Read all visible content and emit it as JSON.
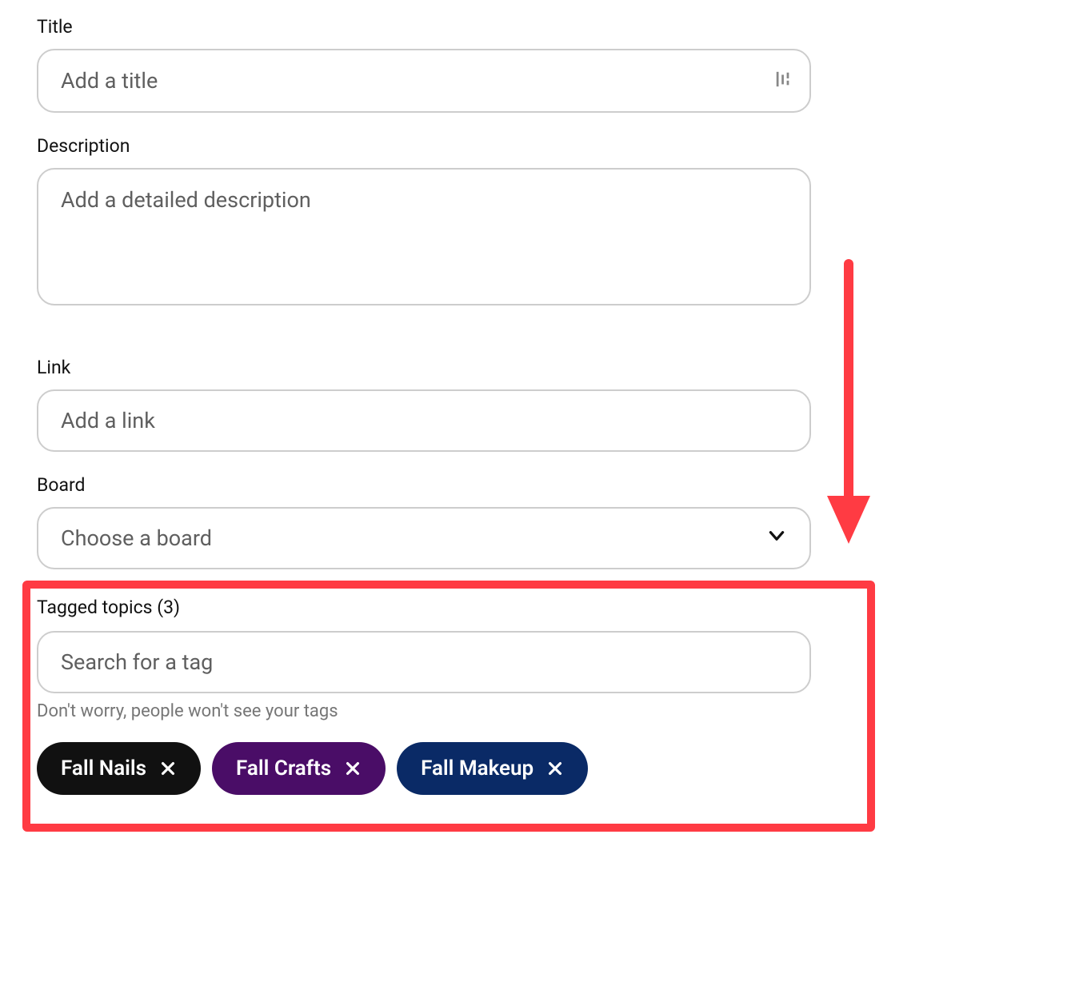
{
  "title": {
    "label": "Title",
    "placeholder": "Add a title"
  },
  "description": {
    "label": "Description",
    "placeholder": "Add a detailed description"
  },
  "link": {
    "label": "Link",
    "placeholder": "Add a link"
  },
  "board": {
    "label": "Board",
    "placeholder": "Choose a board"
  },
  "tagged": {
    "label": "Tagged topics (3)",
    "search_placeholder": "Search for a tag",
    "hint": "Don't worry, people won't see your tags",
    "tags": [
      {
        "name": "Fall Nails",
        "color": "#111111"
      },
      {
        "name": "Fall Crafts",
        "color": "#4a0d67"
      },
      {
        "name": "Fall Makeup",
        "color": "#0a2a66"
      }
    ]
  },
  "annotations": {
    "arrow_color": "#ff3b43",
    "highlight_color": "#ff3b43"
  }
}
